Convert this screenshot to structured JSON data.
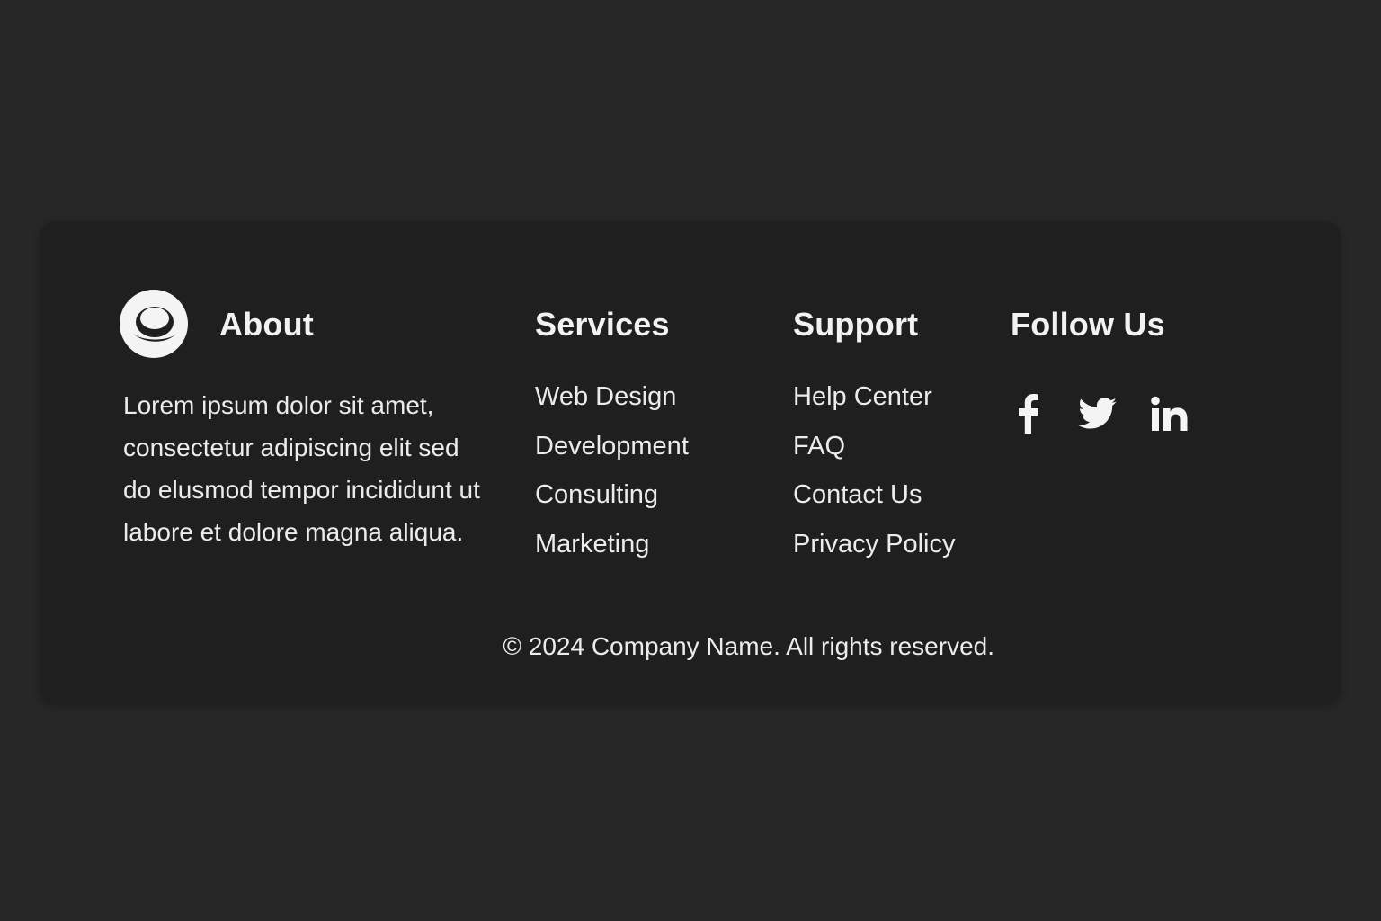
{
  "about": {
    "heading": "About",
    "logo_icon": "circle-smile-logo",
    "text": "Lorem ipsum  dolor sit amet, consectetur adipiscing elit sed do elusmod tempor incididunt ut labore et dolore magna aliqua."
  },
  "services": {
    "heading": "Services",
    "items": [
      "Web Design",
      "Development",
      "Consulting",
      "Marketing"
    ]
  },
  "support": {
    "heading": "Support",
    "items": [
      "Help Center",
      "FAQ",
      "Contact Us",
      "Privacy Policy"
    ]
  },
  "follow": {
    "heading": "Follow Us",
    "icons": [
      "facebook-icon",
      "twitter-icon",
      "linkedin-icon"
    ]
  },
  "copyright": "© 2024 Company Name. All rights reserved.",
  "colors": {
    "background": "#272727",
    "card": "#1f1f1f",
    "text": "#f2f2f2"
  }
}
